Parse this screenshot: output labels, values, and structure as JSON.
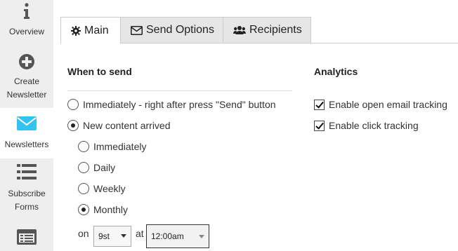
{
  "sidebar": {
    "items": [
      {
        "label": "Overview",
        "icon": "info-icon"
      },
      {
        "label": "Create Newsletter",
        "icon": "plus-circle-icon"
      },
      {
        "label": "Newsletters",
        "icon": "envelope-icon",
        "active": true
      },
      {
        "label": "Subscribe Forms",
        "icon": "list-icon"
      },
      {
        "label": "",
        "icon": "form-icon"
      }
    ]
  },
  "tabs": [
    {
      "label": "Main",
      "icon": "gear-icon",
      "active": true
    },
    {
      "label": "Send Options",
      "icon": "envelope-outline-icon"
    },
    {
      "label": "Recipients",
      "icon": "users-icon"
    }
  ],
  "when_to_send": {
    "heading": "When to send",
    "immediately_label": "Immediately - right after press \"Send\" button",
    "new_content_label": "New content arrived",
    "sub_options": [
      "Immediately",
      "Daily",
      "Weekly",
      "Monthly"
    ],
    "on_label": "on",
    "day_value": "9st",
    "at_label": "at",
    "time_value": "12:00am"
  },
  "analytics": {
    "heading": "Analytics",
    "open_tracking_label": "Enable open email tracking",
    "click_tracking_label": "Enable click tracking"
  },
  "colors": {
    "sidebar_bg": "#eeeeee",
    "accent": "#33c3f0",
    "icon_gray": "#555555"
  }
}
